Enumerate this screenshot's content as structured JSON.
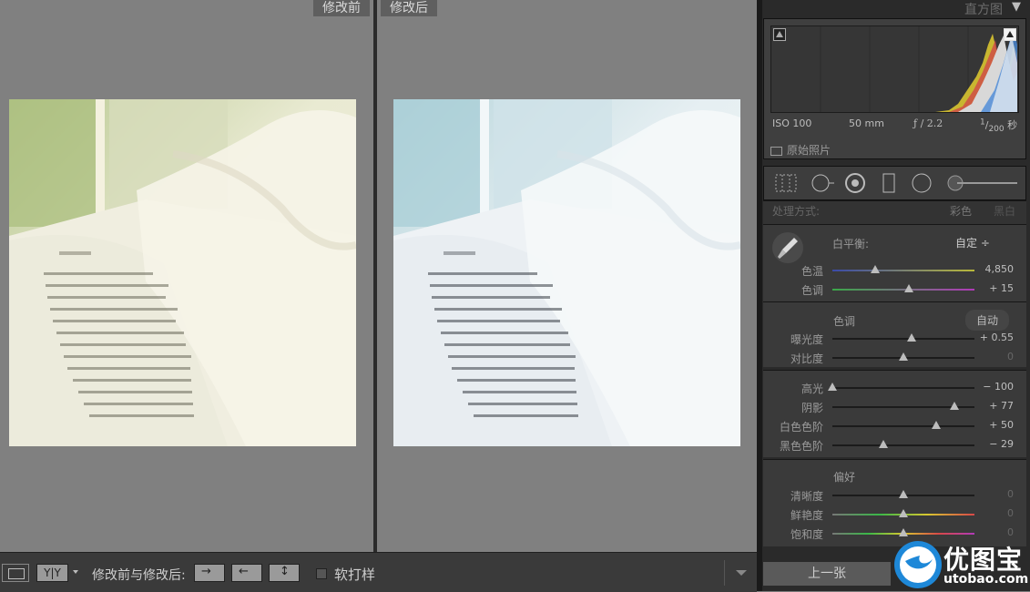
{
  "viewer": {
    "before_label": "修改前",
    "after_label": "修改后"
  },
  "bottombar": {
    "view_toggle_label": "Y|Y",
    "compare_label": "修改前与修改后:",
    "soft_proof_label": "软打样"
  },
  "histogram": {
    "title": "直方图",
    "iso": "ISO 100",
    "focal": "50 mm",
    "aperture": "ƒ / 2.2",
    "shutter_num": "1",
    "shutter_den": "200",
    "shutter_unit": "秒",
    "original_label": "原始照片"
  },
  "basic": {
    "treatment_label": "处理方式:",
    "color_label": "彩色",
    "bw_label": "黑白",
    "wb_label": "白平衡:",
    "wb_value": "自定 ÷",
    "temp_label": "色温",
    "temp_value": "4,850",
    "temp_pos": 0.3,
    "tint_label": "色调",
    "tint_value": "+ 15",
    "tint_pos": 0.54,
    "tone_title": "色调",
    "auto_label": "自动",
    "exposure_label": "曝光度",
    "exposure_value": "+ 0.55",
    "exposure_pos": 0.555,
    "contrast_label": "对比度",
    "contrast_value": "0",
    "contrast_pos": 0.5,
    "highlights_label": "高光",
    "highlights_value": "− 100",
    "highlights_pos": 0.0,
    "shadows_label": "阴影",
    "shadows_value": "+ 77",
    "shadows_pos": 0.86,
    "whites_label": "白色色阶",
    "whites_value": "+ 50",
    "whites_pos": 0.73,
    "blacks_label": "黑色色阶",
    "blacks_value": "− 29",
    "blacks_pos": 0.36,
    "presence_title": "偏好",
    "clarity_label": "清晰度",
    "clarity_value": "0",
    "clarity_pos": 0.5,
    "vibrance_label": "鲜艳度",
    "vibrance_value": "0",
    "vibrance_pos": 0.5,
    "saturation_label": "饱和度",
    "saturation_value": "0",
    "saturation_pos": 0.5
  },
  "footer": {
    "prev_label": "上一张",
    "logo_cn": "优图宝",
    "logo_url": "utobao.com"
  },
  "colors": {
    "panel_bg": "#3a3a3a",
    "accent_blue": "#1e88d8"
  }
}
